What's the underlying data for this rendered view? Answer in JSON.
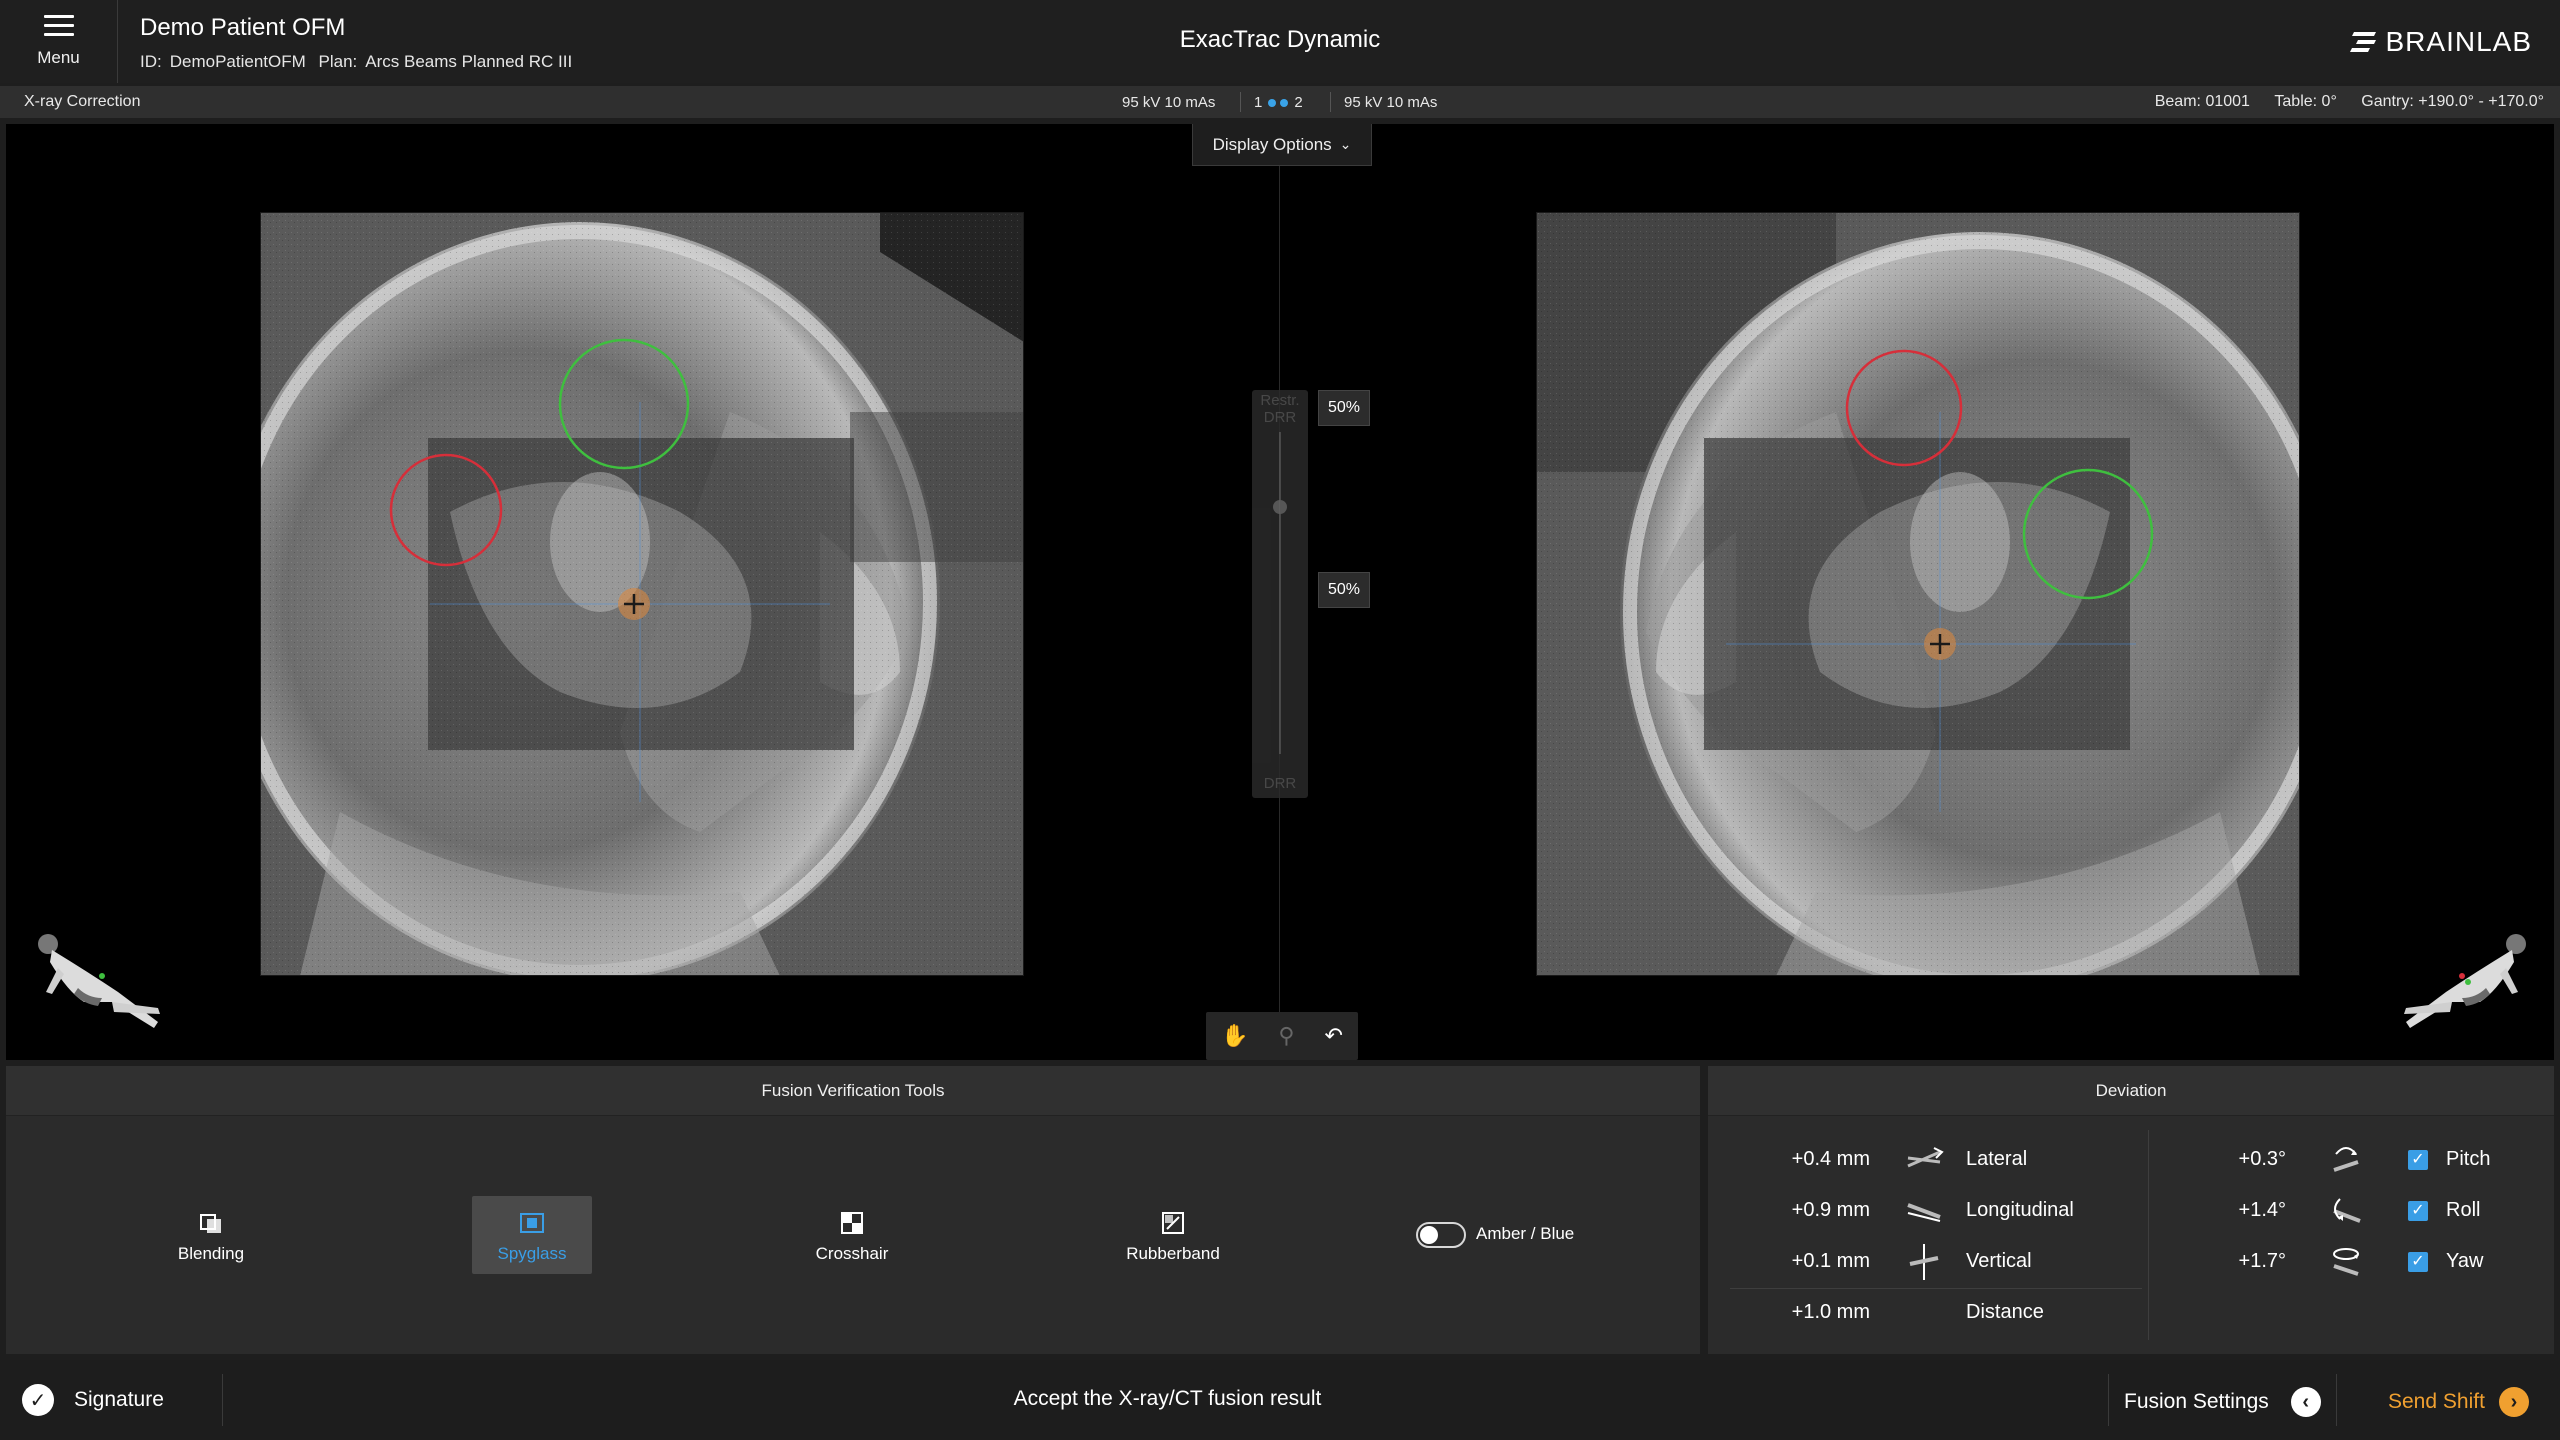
{
  "header": {
    "menu_label": "Menu",
    "patient_name": "Demo Patient OFM",
    "id_label": "ID:",
    "id_value": "DemoPatientOFM",
    "plan_label": "Plan:",
    "plan_value": "Arcs Beams Planned RC III",
    "app_title": "ExacTrac Dynamic",
    "brand": "BRAINLAB"
  },
  "statusbar": {
    "title": "X-ray Correction",
    "left_exposure": "95 kV 10 mAs",
    "tube_1": "1",
    "tube_2": "2",
    "right_exposure": "95 kV 10 mAs",
    "beam_label": "Beam:",
    "beam_value": "01001",
    "table_label": "Table:",
    "table_value": "0°",
    "gantry_label": "Gantry:",
    "gantry_value": "+190.0° - +170.0°"
  },
  "viewer": {
    "display_options": "Display Options",
    "slider_top_label": "Restr. DRR",
    "slider_bottom_label": "DRR",
    "top_percent": "50%",
    "bottom_percent": "50%",
    "colors": {
      "target_green": "#3fbf3f",
      "target_red": "#d62f3a",
      "isocenter": "#e0883a"
    }
  },
  "fusion_tools": {
    "title": "Fusion Verification Tools",
    "tools": [
      {
        "label": "Blending",
        "icon": "blending-icon",
        "active": false
      },
      {
        "label": "Spyglass",
        "icon": "spyglass-icon",
        "active": true
      },
      {
        "label": "Crosshair",
        "icon": "crosshair-icon",
        "active": false
      },
      {
        "label": "Rubberband",
        "icon": "rubberband-icon",
        "active": false
      }
    ],
    "toggle_label": "Amber / Blue",
    "toggle_on": false
  },
  "deviation": {
    "title": "Deviation",
    "translations": [
      {
        "value": "+0.4 mm",
        "label": "Lateral"
      },
      {
        "value": "+0.9 mm",
        "label": "Longitudinal"
      },
      {
        "value": "+0.1 mm",
        "label": "Vertical"
      },
      {
        "value": "+1.0 mm",
        "label": "Distance"
      }
    ],
    "rotations": [
      {
        "value": "+0.3°",
        "label": "Pitch",
        "checked": true
      },
      {
        "value": "+1.4°",
        "label": "Roll",
        "checked": true
      },
      {
        "value": "+1.7°",
        "label": "Yaw",
        "checked": true
      }
    ]
  },
  "footer": {
    "signature": "Signature",
    "message": "Accept the X-ray/CT fusion result",
    "fusion_settings": "Fusion Settings",
    "send_shift": "Send Shift",
    "accent": "#f0a030"
  }
}
